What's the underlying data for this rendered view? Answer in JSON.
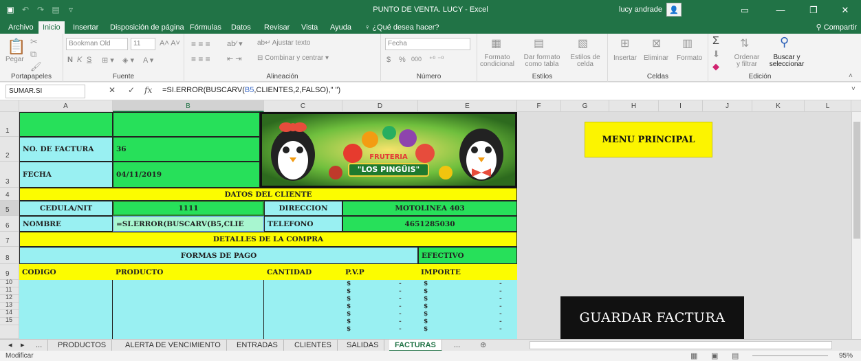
{
  "window": {
    "title": "PUNTO DE VENTA. LUCY  -  Excel",
    "user": "lucy andrade",
    "controls": {
      "minimize": "—",
      "restore": "❐",
      "close": "✕"
    }
  },
  "ribbon_tabs": [
    "Archivo",
    "Inicio",
    "Insertar",
    "Disposición de página",
    "Fórmulas",
    "Datos",
    "Revisar",
    "Vista",
    "Ayuda"
  ],
  "active_tab": "Inicio",
  "tell_me": "¿Qué desea hacer?",
  "share": "Compartir",
  "ribbon": {
    "portapapeles": {
      "label": "Portapapeles",
      "paste": "Pegar"
    },
    "fuente": {
      "label": "Fuente",
      "font_name": "Bookman Old",
      "font_size": "11",
      "bold": "N",
      "italic": "K",
      "underline": "S"
    },
    "alineacion": {
      "label": "Alineación",
      "wrap": "Ajustar texto",
      "merge": "Combinar y centrar"
    },
    "numero": {
      "label": "Número",
      "format": "Fecha",
      "currency": "$",
      "percent": "%",
      "thousands": "000"
    },
    "estilos": {
      "label": "Estilos",
      "cond": "Formato condicional",
      "table": "Dar formato como tabla",
      "cell_styles": "Estilos de celda"
    },
    "celdas": {
      "label": "Celdas",
      "insert": "Insertar",
      "delete": "Eliminar",
      "format": "Formato"
    },
    "edicion": {
      "label": "Edición",
      "sort": "Ordenar y filtrar",
      "find": "Buscar y seleccionar"
    }
  },
  "formula_bar": {
    "name_box": "SUMAR.SI",
    "formula_prefix": "=SI.ERROR(BUSCARV(",
    "formula_ref": "B5",
    "formula_suffix": ",CLIENTES,2,FALSO),\" \")"
  },
  "columns": [
    "A",
    "B",
    "C",
    "D",
    "E",
    "F",
    "G",
    "H",
    "I",
    "J",
    "K",
    "L"
  ],
  "rows": [
    "1",
    "2",
    "3",
    "4",
    "5",
    "6",
    "7",
    "8",
    "9",
    "10",
    "11",
    "12",
    "13",
    "14",
    "15"
  ],
  "invoice": {
    "no_factura_label": "NO. DE FACTURA",
    "no_factura": "36",
    "fecha_label": "FECHA",
    "fecha": "04/11/2019",
    "datos_cliente": "DATOS DEL CLIENTE",
    "cedula_label": "CEDULA/NIT",
    "cedula": "1111",
    "direccion_label": "DIRECCION",
    "direccion": "MOTOLINEA 403",
    "nombre_label": "NOMBRE",
    "nombre_formula": "=SI.ERROR(BUSCARV(B5,CLIE",
    "telefono_label": "TELEFONO",
    "telefono": "4651285030",
    "detalles": "DETALLES DE LA COMPRA",
    "formas_pago": "FORMAS DE PAGO",
    "efectivo": "EFECTIVO",
    "headers": {
      "codigo": "CODIGO",
      "producto": "PRODUCTO",
      "cantidad": "CANTIDAD",
      "pvp": "P.V.P",
      "importe": "IMPORTE"
    },
    "currency_symbol": "$",
    "dash": "-"
  },
  "logo": {
    "line1": "FRUTERIA",
    "line2": "\"LOS PINGÜIS\""
  },
  "buttons": {
    "menu_principal": "MENU PRINCIPAL",
    "guardar_factura": "GUARDAR FACTURA"
  },
  "sheet_tabs": [
    "...",
    "PRODUCTOS",
    "ALERTA DE VENCIMIENTO",
    "ENTRADAS",
    "CLIENTES",
    "SALIDAS",
    "FACTURAS",
    "..."
  ],
  "active_sheet": "FACTURAS",
  "status": {
    "mode": "Modificar",
    "zoom": "95%"
  }
}
